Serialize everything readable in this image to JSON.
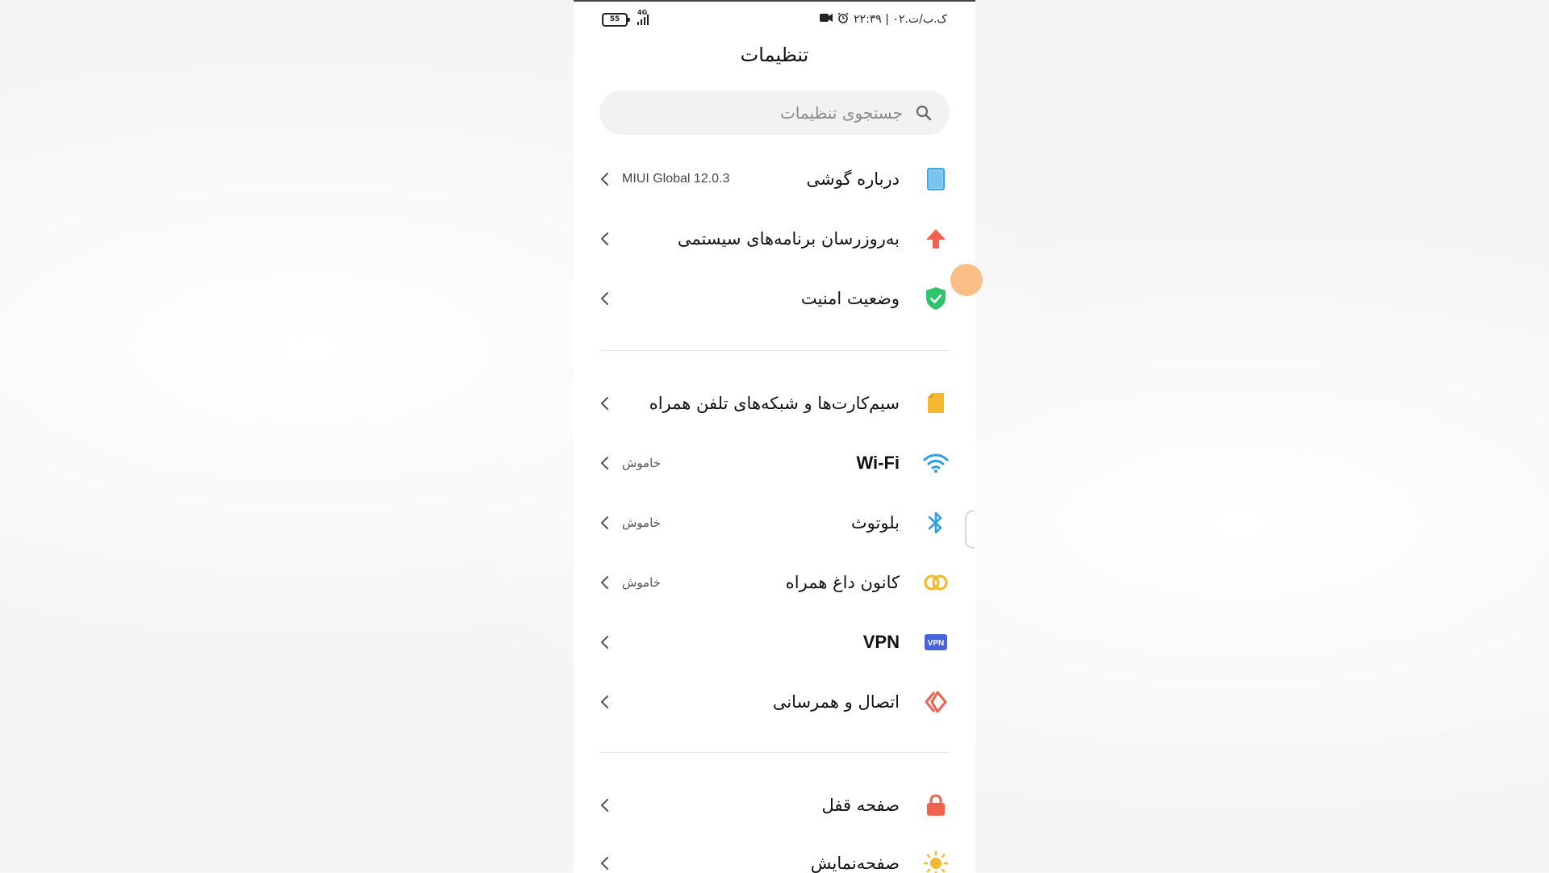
{
  "status_bar": {
    "battery": "55",
    "network": "4G",
    "time_date": "۲۲:۳۹ | ۰۲.ک.ب/ت"
  },
  "header": {
    "title": "تنظیمات"
  },
  "search": {
    "placeholder": "جستجوی تنظیمات"
  },
  "sections": [
    [
      {
        "id": "about-phone",
        "label": "درباره گوشی",
        "value": "MIUI Global 12.0.3",
        "icon": "phone-icon",
        "color": "#3aa7e8"
      },
      {
        "id": "system-updater",
        "label": "به‌روزرسان برنامه‌های سیستمی",
        "value": "",
        "icon": "arrow-up-icon",
        "color": "#f0624d"
      },
      {
        "id": "security-status",
        "label": "وضعیت امنیت",
        "value": "",
        "icon": "shield-check-icon",
        "color": "#2ec46e"
      }
    ],
    [
      {
        "id": "sim-cards",
        "label": "سیم‌کارت‌ها و شبکه‌های تلفن همراه",
        "value": "",
        "icon": "sim-card-icon",
        "color": "#f5b82e"
      },
      {
        "id": "wifi",
        "label": "Wi-Fi",
        "value": "خاموش",
        "icon": "wifi-icon",
        "color": "#2b9fe6"
      },
      {
        "id": "bluetooth",
        "label": "بلوتوث",
        "value": "خاموش",
        "icon": "bluetooth-icon",
        "color": "#2b9fe6"
      },
      {
        "id": "hotspot",
        "label": "کانون داغ همراه",
        "value": "خاموش",
        "icon": "hotspot-icon",
        "color": "#f5b82e"
      },
      {
        "id": "vpn",
        "label": "VPN",
        "value": "",
        "icon": "vpn-icon",
        "color": "#4a63d8"
      },
      {
        "id": "connection-sharing",
        "label": "اتصال و همرسانی",
        "value": "",
        "icon": "connection-sharing-icon",
        "color": "#f0624d"
      }
    ],
    [
      {
        "id": "lock-screen",
        "label": "صفحه قفل",
        "value": "",
        "icon": "lock-icon",
        "color": "#f0624d"
      },
      {
        "id": "display",
        "label": "صفحه‌نمایش",
        "value": "",
        "icon": "sun-icon",
        "color": "#f5b82e"
      }
    ]
  ]
}
